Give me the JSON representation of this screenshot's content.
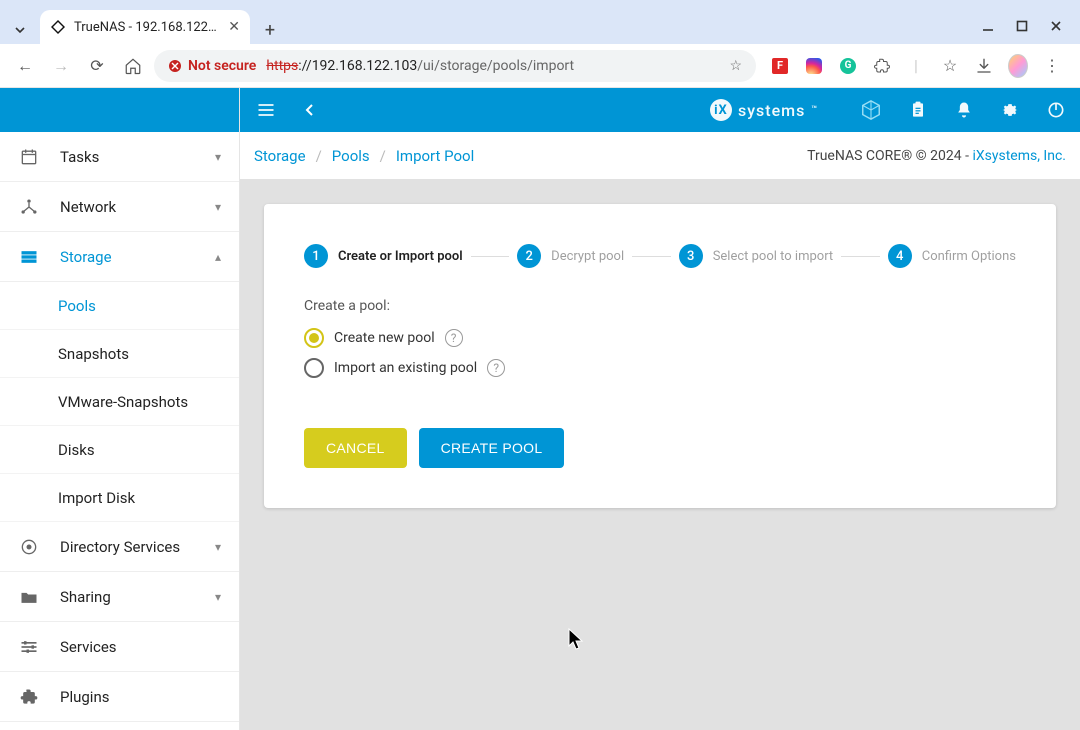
{
  "browser": {
    "tab_title": "TrueNAS - 192.168.122…",
    "url_https": "https",
    "url_host": "://192.168.122.103",
    "url_path": "/ui/storage/pools/import",
    "not_secure": "Not secure"
  },
  "topbar": {
    "brand": "systems"
  },
  "sidebar": {
    "items": [
      {
        "label": "Tasks",
        "expandable": true,
        "expanded": false
      },
      {
        "label": "Network",
        "expandable": true,
        "expanded": false
      },
      {
        "label": "Storage",
        "expandable": true,
        "expanded": true,
        "active": true,
        "children": [
          {
            "label": "Pools",
            "active": true
          },
          {
            "label": "Snapshots"
          },
          {
            "label": "VMware-Snapshots"
          },
          {
            "label": "Disks"
          },
          {
            "label": "Import Disk"
          }
        ]
      },
      {
        "label": "Directory Services",
        "expandable": true,
        "expanded": false
      },
      {
        "label": "Sharing",
        "expandable": true,
        "expanded": false
      },
      {
        "label": "Services",
        "expandable": false
      },
      {
        "label": "Plugins",
        "expandable": false
      }
    ]
  },
  "breadcrumb": {
    "items": [
      "Storage",
      "Pools",
      "Import Pool"
    ],
    "copyright": "TrueNAS CORE® © 2024 - ",
    "copyright_link": "iXsystems, Inc."
  },
  "stepper": {
    "steps": [
      {
        "num": "1",
        "label": "Create or Import pool",
        "active": true
      },
      {
        "num": "2",
        "label": "Decrypt pool"
      },
      {
        "num": "3",
        "label": "Select pool to import"
      },
      {
        "num": "4",
        "label": "Confirm Options"
      }
    ]
  },
  "form": {
    "legend": "Create a pool:",
    "radios": [
      {
        "label": "Create new pool",
        "selected": true
      },
      {
        "label": "Import an existing pool",
        "selected": false
      }
    ],
    "cancel": "CANCEL",
    "submit": "CREATE POOL"
  }
}
